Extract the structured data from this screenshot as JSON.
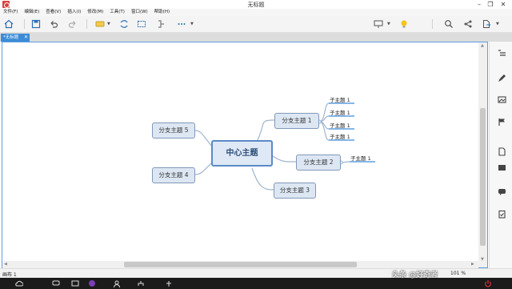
{
  "window": {
    "title": "无标题",
    "minimize": "–",
    "restore": "❐",
    "close": "✕"
  },
  "menu": [
    "文件(F)",
    "编辑(E)",
    "查看(V)",
    "插入(I)",
    "修改(M)",
    "工具(T)",
    "窗口(W)",
    "帮助(H)"
  ],
  "toolbar": {
    "icons": [
      "home-icon",
      "save-icon",
      "undo-icon",
      "redo-icon",
      "topic-style-icon",
      "relationship-icon",
      "boundary-icon",
      "summary-icon",
      "more-icon",
      "presentation-icon",
      "idea-icon",
      "search-icon",
      "share-icon",
      "export-icon"
    ]
  },
  "tab": {
    "label": "*无标题",
    "close": "✕"
  },
  "mindmap": {
    "central": "中心主题",
    "branches": [
      {
        "label": "分支主题 1",
        "subtopics": [
          "子主题 1",
          "子主题 1",
          "子主题 1",
          "子主题 1"
        ]
      },
      {
        "label": "分支主题 2",
        "subtopics": [
          "子主题 1"
        ]
      },
      {
        "label": "分支主题 3",
        "subtopics": []
      },
      {
        "label": "分支主题 4",
        "subtopics": []
      },
      {
        "label": "分支主题 5",
        "subtopics": []
      }
    ]
  },
  "sidepanel": {
    "icons": [
      "outline-icon",
      "style-brush-icon",
      "image-icon",
      "flag-icon",
      "note-icon",
      "label-icon",
      "comment-icon",
      "task-icon"
    ]
  },
  "status": {
    "left": "画布 1",
    "zoom": "101 %"
  },
  "colors": {
    "accent": "#3c8bd6",
    "node_fill": "#dde7f3",
    "node_border": "#7f98b8",
    "connector": "#9fb5cf"
  },
  "watermark": "头条 @好奇者"
}
